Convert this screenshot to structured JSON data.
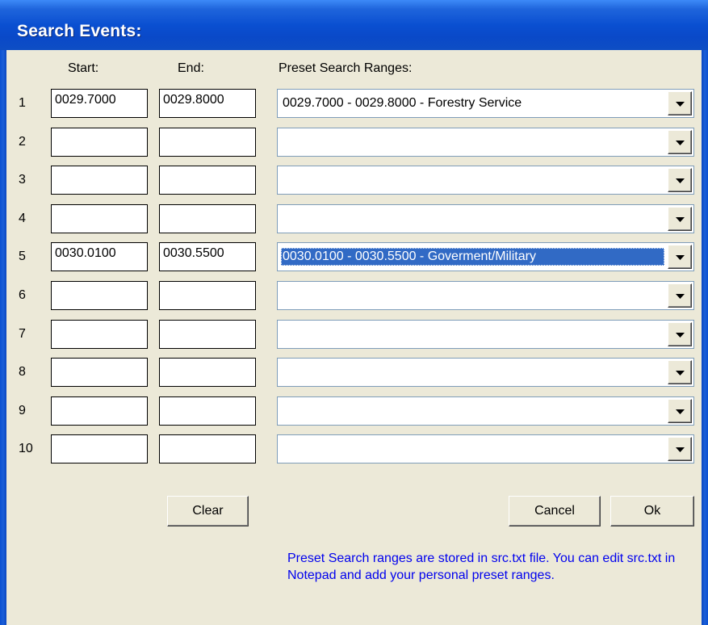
{
  "window": {
    "title": "Search Events:"
  },
  "headers": {
    "start": "Start:",
    "end": "End:",
    "preset": "Preset Search Ranges:"
  },
  "rows": [
    {
      "num": "1",
      "start": "0029.7000",
      "end": "0029.8000",
      "preset": "0029.7000 - 0029.8000 - Forestry Service",
      "selected": false
    },
    {
      "num": "2",
      "start": "",
      "end": "",
      "preset": "",
      "selected": false
    },
    {
      "num": "3",
      "start": "",
      "end": "",
      "preset": "",
      "selected": false
    },
    {
      "num": "4",
      "start": "",
      "end": "",
      "preset": "",
      "selected": false
    },
    {
      "num": "5",
      "start": "0030.0100",
      "end": "0030.5500",
      "preset": "0030.0100 - 0030.5500 - Goverment/Military",
      "selected": true
    },
    {
      "num": "6",
      "start": "",
      "end": "",
      "preset": "",
      "selected": false
    },
    {
      "num": "7",
      "start": "",
      "end": "",
      "preset": "",
      "selected": false
    },
    {
      "num": "8",
      "start": "",
      "end": "",
      "preset": "",
      "selected": false
    },
    {
      "num": "9",
      "start": "",
      "end": "",
      "preset": "",
      "selected": false
    },
    {
      "num": "10",
      "start": "",
      "end": "",
      "preset": "",
      "selected": false
    }
  ],
  "buttons": {
    "clear": "Clear",
    "cancel": "Cancel",
    "ok": "Ok"
  },
  "note": "Preset Search ranges are stored in src.txt file.    You can edit src.txt in Notepad and add your personal preset ranges.",
  "icons": {
    "dropdown": "chevron-down-icon"
  },
  "colors": {
    "titlebar": "#0a4fd1",
    "selection": "#316ac5",
    "note_text": "#0000ee",
    "face": "#ece9d8"
  }
}
